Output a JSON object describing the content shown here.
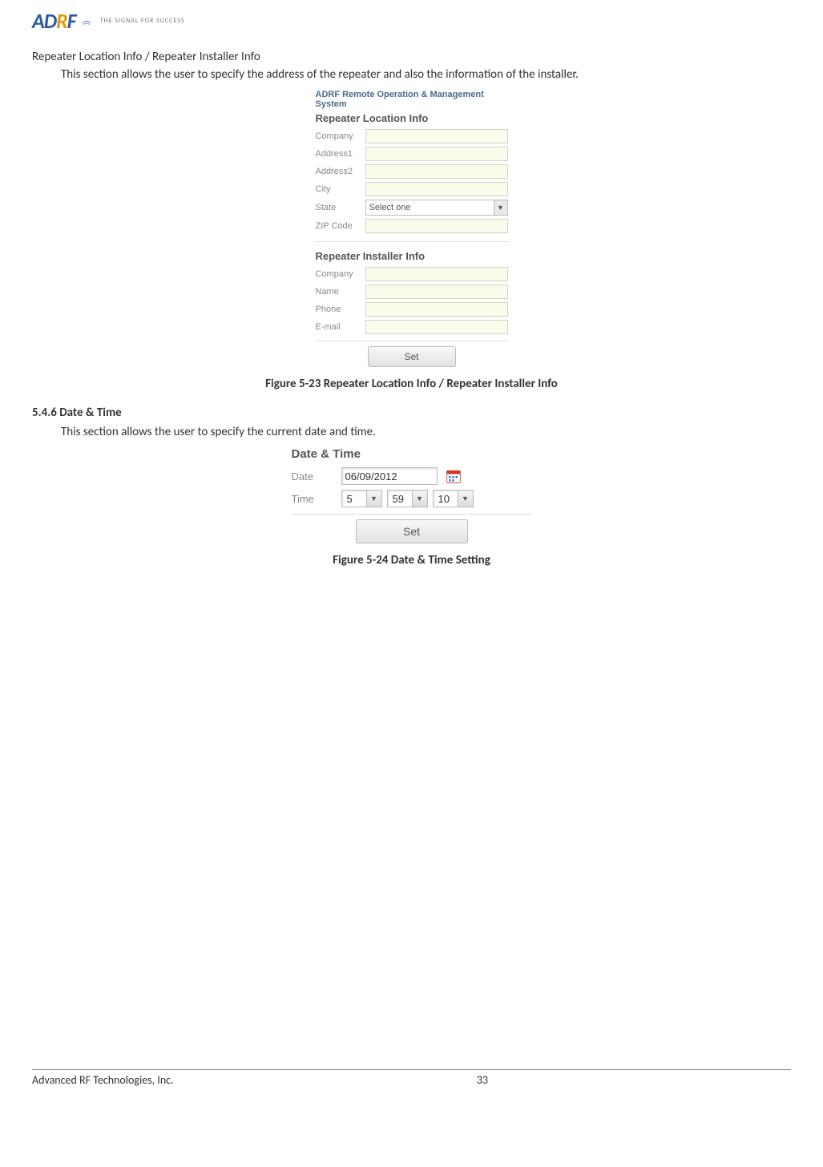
{
  "logo": {
    "letters": [
      "A",
      "D",
      "R",
      "F"
    ],
    "tagline": "THE SIGNAL FOR SUCCESS"
  },
  "section1": {
    "title": "Repeater Location Info / Repeater Installer Info",
    "desc": "This section allows the user to specify the address of the repeater and also the information of the installer."
  },
  "panel1": {
    "banner": "ADRF Remote Operation & Management System",
    "location_heading": "Repeater Location Info",
    "loc_fields": {
      "company": "Company",
      "address1": "Address1",
      "address2": "Address2",
      "city": "City",
      "state": "State",
      "zip": "ZIP Code"
    },
    "state_value": "Select one",
    "installer_heading": "Repeater Installer Info",
    "inst_fields": {
      "company": "Company",
      "name": "Name",
      "phone": "Phone",
      "email": "E-mail"
    },
    "set_label": "Set"
  },
  "caption1": "Figure 5-23   Repeater Location Info / Repeater Installer Info",
  "section2": {
    "num_title": "5.4.6   Date & Time",
    "desc": "This section allows the user to specify the current date and time."
  },
  "panel2": {
    "heading": "Date & Time",
    "date_label": "Date",
    "date_value": "06/09/2012",
    "time_label": "Time",
    "time": {
      "h": "5",
      "m": "59",
      "s": "10"
    },
    "set_label": "Set"
  },
  "caption2": "Figure 5-24   Date & Time Setting",
  "footer": {
    "company": "Advanced RF Technologies, Inc.",
    "page": "33"
  }
}
